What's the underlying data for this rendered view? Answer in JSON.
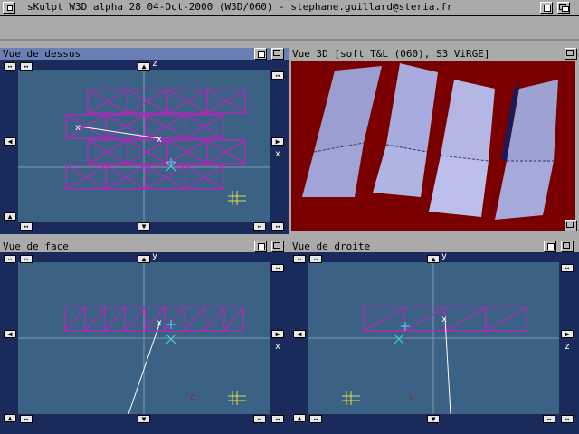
{
  "app": {
    "title": "sKulpt W3D alpha 28 04-Oct-2000 (W3D/060) - stephane.guillard@steria.fr"
  },
  "windows": {
    "top": {
      "title": "Vue de dessus",
      "axis_h": "x",
      "axis_v": "z"
    },
    "view3d": {
      "title": "Vue 3D [soft T&L (060), S3 ViRGE]"
    },
    "front": {
      "title": "Vue de face",
      "axis_h": "x",
      "axis_v": "y"
    },
    "right": {
      "title": "Vue de droite",
      "axis_h": "z",
      "axis_v": "y"
    }
  },
  "glyphs": {
    "up": "▲",
    "down": "▼",
    "left": "◀",
    "right": "▶",
    "leftright": "↔",
    "updown": "↕"
  },
  "colors": {
    "viewport_bg": "#3b6285",
    "mesh": "#c020c0",
    "render_bg": "#7a0000",
    "plane": "#a8acd8",
    "cursor": "#40d0e0"
  }
}
